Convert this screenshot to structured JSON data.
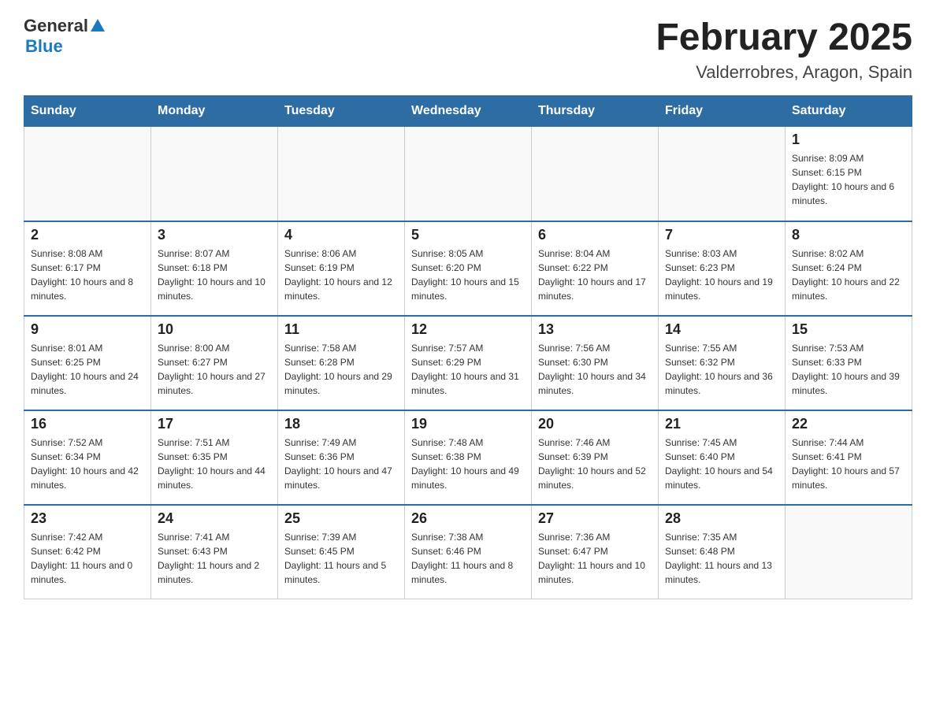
{
  "header": {
    "logo_general": "General",
    "logo_blue": "Blue",
    "month_title": "February 2025",
    "location": "Valderrobres, Aragon, Spain"
  },
  "weekdays": [
    "Sunday",
    "Monday",
    "Tuesday",
    "Wednesday",
    "Thursday",
    "Friday",
    "Saturday"
  ],
  "weeks": [
    [
      {
        "day": "",
        "info": ""
      },
      {
        "day": "",
        "info": ""
      },
      {
        "day": "",
        "info": ""
      },
      {
        "day": "",
        "info": ""
      },
      {
        "day": "",
        "info": ""
      },
      {
        "day": "",
        "info": ""
      },
      {
        "day": "1",
        "info": "Sunrise: 8:09 AM\nSunset: 6:15 PM\nDaylight: 10 hours and 6 minutes."
      }
    ],
    [
      {
        "day": "2",
        "info": "Sunrise: 8:08 AM\nSunset: 6:17 PM\nDaylight: 10 hours and 8 minutes."
      },
      {
        "day": "3",
        "info": "Sunrise: 8:07 AM\nSunset: 6:18 PM\nDaylight: 10 hours and 10 minutes."
      },
      {
        "day": "4",
        "info": "Sunrise: 8:06 AM\nSunset: 6:19 PM\nDaylight: 10 hours and 12 minutes."
      },
      {
        "day": "5",
        "info": "Sunrise: 8:05 AM\nSunset: 6:20 PM\nDaylight: 10 hours and 15 minutes."
      },
      {
        "day": "6",
        "info": "Sunrise: 8:04 AM\nSunset: 6:22 PM\nDaylight: 10 hours and 17 minutes."
      },
      {
        "day": "7",
        "info": "Sunrise: 8:03 AM\nSunset: 6:23 PM\nDaylight: 10 hours and 19 minutes."
      },
      {
        "day": "8",
        "info": "Sunrise: 8:02 AM\nSunset: 6:24 PM\nDaylight: 10 hours and 22 minutes."
      }
    ],
    [
      {
        "day": "9",
        "info": "Sunrise: 8:01 AM\nSunset: 6:25 PM\nDaylight: 10 hours and 24 minutes."
      },
      {
        "day": "10",
        "info": "Sunrise: 8:00 AM\nSunset: 6:27 PM\nDaylight: 10 hours and 27 minutes."
      },
      {
        "day": "11",
        "info": "Sunrise: 7:58 AM\nSunset: 6:28 PM\nDaylight: 10 hours and 29 minutes."
      },
      {
        "day": "12",
        "info": "Sunrise: 7:57 AM\nSunset: 6:29 PM\nDaylight: 10 hours and 31 minutes."
      },
      {
        "day": "13",
        "info": "Sunrise: 7:56 AM\nSunset: 6:30 PM\nDaylight: 10 hours and 34 minutes."
      },
      {
        "day": "14",
        "info": "Sunrise: 7:55 AM\nSunset: 6:32 PM\nDaylight: 10 hours and 36 minutes."
      },
      {
        "day": "15",
        "info": "Sunrise: 7:53 AM\nSunset: 6:33 PM\nDaylight: 10 hours and 39 minutes."
      }
    ],
    [
      {
        "day": "16",
        "info": "Sunrise: 7:52 AM\nSunset: 6:34 PM\nDaylight: 10 hours and 42 minutes."
      },
      {
        "day": "17",
        "info": "Sunrise: 7:51 AM\nSunset: 6:35 PM\nDaylight: 10 hours and 44 minutes."
      },
      {
        "day": "18",
        "info": "Sunrise: 7:49 AM\nSunset: 6:36 PM\nDaylight: 10 hours and 47 minutes."
      },
      {
        "day": "19",
        "info": "Sunrise: 7:48 AM\nSunset: 6:38 PM\nDaylight: 10 hours and 49 minutes."
      },
      {
        "day": "20",
        "info": "Sunrise: 7:46 AM\nSunset: 6:39 PM\nDaylight: 10 hours and 52 minutes."
      },
      {
        "day": "21",
        "info": "Sunrise: 7:45 AM\nSunset: 6:40 PM\nDaylight: 10 hours and 54 minutes."
      },
      {
        "day": "22",
        "info": "Sunrise: 7:44 AM\nSunset: 6:41 PM\nDaylight: 10 hours and 57 minutes."
      }
    ],
    [
      {
        "day": "23",
        "info": "Sunrise: 7:42 AM\nSunset: 6:42 PM\nDaylight: 11 hours and 0 minutes."
      },
      {
        "day": "24",
        "info": "Sunrise: 7:41 AM\nSunset: 6:43 PM\nDaylight: 11 hours and 2 minutes."
      },
      {
        "day": "25",
        "info": "Sunrise: 7:39 AM\nSunset: 6:45 PM\nDaylight: 11 hours and 5 minutes."
      },
      {
        "day": "26",
        "info": "Sunrise: 7:38 AM\nSunset: 6:46 PM\nDaylight: 11 hours and 8 minutes."
      },
      {
        "day": "27",
        "info": "Sunrise: 7:36 AM\nSunset: 6:47 PM\nDaylight: 11 hours and 10 minutes."
      },
      {
        "day": "28",
        "info": "Sunrise: 7:35 AM\nSunset: 6:48 PM\nDaylight: 11 hours and 13 minutes."
      },
      {
        "day": "",
        "info": ""
      }
    ]
  ]
}
